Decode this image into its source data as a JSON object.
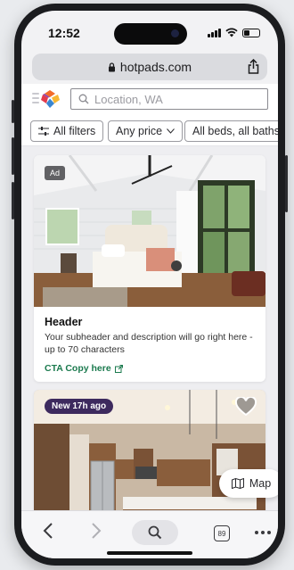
{
  "status_bar": {
    "time": "12:52"
  },
  "browser": {
    "url": "hotpads.com"
  },
  "search": {
    "placeholder": "Location, WA"
  },
  "filters": [
    {
      "label": "All filters"
    },
    {
      "label": "Any price"
    },
    {
      "label": "All beds, all baths"
    }
  ],
  "ad_card": {
    "badge": "Ad",
    "title": "Header",
    "description": "Your subheader and description will go right here - up to 70 characters",
    "cta": "CTA Copy here"
  },
  "listing_card": {
    "badge": "New 17h ago"
  },
  "map_button": {
    "label": "Map"
  },
  "toolbar": {
    "tabs_count": "89"
  },
  "colors": {
    "accent_green": "#1b7a4e",
    "badge_purple": "#3d2a5e"
  }
}
